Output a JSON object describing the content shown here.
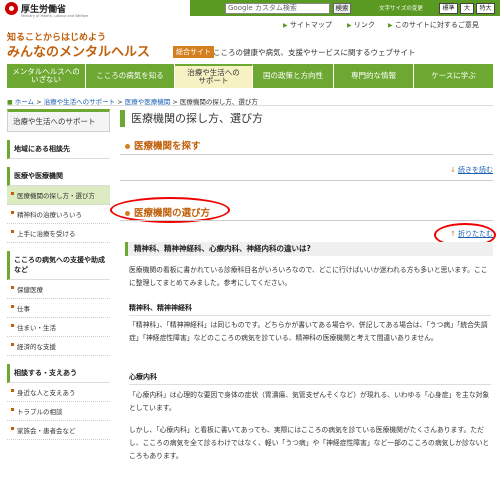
{
  "header": {
    "logo_text": "厚生労働省",
    "logo_sub": "Ministry of Health, Labour and Welfare",
    "search_placeholder": "Google カスタム検索",
    "search_button": "検索",
    "font_size_label": "文字サイズの変更",
    "font_sizes": [
      "標準",
      "大",
      "特大"
    ],
    "links": [
      "サイトマップ",
      "リンク",
      "このサイトに対するご意見"
    ]
  },
  "brand": {
    "tagline_top": "知ることからはじめよう",
    "title": "みんなのメンタルヘルス",
    "badge": "総合サイト",
    "description": "こころの健康や病気、支援やサービスに関するウェブサイト"
  },
  "gnav": [
    {
      "label": "メンタルヘルスへの\nいざない"
    },
    {
      "label": "こころの病気を知る"
    },
    {
      "label": "治療や生活への\nサポート",
      "active": true
    },
    {
      "label": "国の政策と方向性"
    },
    {
      "label": "専門的な情報"
    },
    {
      "label": "ケースに学ぶ"
    }
  ],
  "breadcrumb": [
    "ホーム",
    "治療や生活へのサポート",
    "医療や医療機関",
    "医療機関の探し方、選び方"
  ],
  "sidebar": {
    "title": "治療や生活へのサポート",
    "sections": [
      {
        "title": "地域にある相談先",
        "items": []
      },
      {
        "title": "医療や医療機関",
        "items": [
          "医療機関の探し方・選び方",
          "精神科の治療いろいろ",
          "上手に治療を受ける"
        ]
      },
      {
        "title": "こころの病気への支援や助成など",
        "items": [
          "保健医療",
          "仕事",
          "住まい・生活",
          "経済的な支援"
        ]
      },
      {
        "title": "相談する・支えあう",
        "items": [
          "身近な人と支えあう",
          "トラブルの相談",
          "家族会・患者会など"
        ]
      }
    ]
  },
  "main": {
    "title": "医療機関の探し方、選び方",
    "section1": "医療機関を探す",
    "read_more": "続きを読む",
    "section2": "医療機関の選び方",
    "collapse": "折りたたむ",
    "question": "精神科、精神神経科、心療内科、神経内科の違いは?",
    "intro": "医療機関の看板に書かれている診療科目名がいろいろなので、どこに行けばいいか迷われる方も多いと思います。ここに整理してまとめてみました。参考にしてください。",
    "sub1": "精神科、精神神経科",
    "p1": "「精神科」、「精神神経科」は同じものです。どちらかが書いてある場合や、併記してある場合は、「うつ病」「統合失調症」「神経症性障害」などのこころの病気を診ている、精神科の医療機関と考えて間違いありません。",
    "sub2": "心療内科",
    "p2": "「心療内科」は心理的な要因で身体の症状（胃潰瘍、気管支ぜんそくなど）が現れる、いわゆる「心身症」を主な対象としています。",
    "p3": "しかし、「心療内科」と看板に書いてあっても、実際にはこころの病気を診ている医療機関がたくさんあります。ただし、こころの病気を全て診るわけではなく、軽い「うつ病」や「神経症性障害」など一部のこころの病気しか診ないところもあります。"
  }
}
